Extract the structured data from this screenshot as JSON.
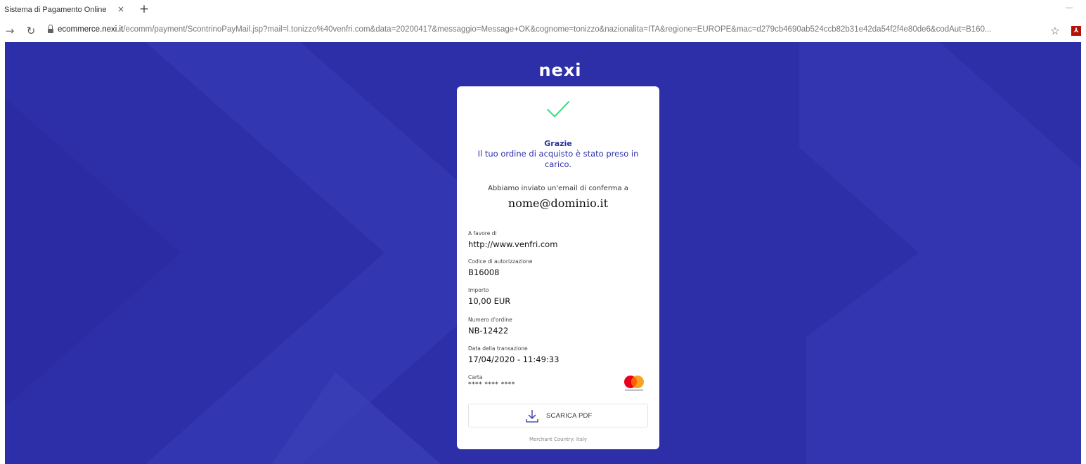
{
  "browser": {
    "tab_title": "Sistema di Pagamento Online",
    "tab_close": "×",
    "new_tab": "+",
    "url_host": "ecommerce.nexi.it",
    "url_path": "/ecomm/payment/ScontrinoPayMail.jsp?mail=l.tonizzo%40venfri.com&data=20200417&messaggio=Message+OK&cognome=tonizzo&nazionalita=ITA&regione=EUROPE&mac=d279cb4690ab524ccb82b31e42da54f2f4e80de6&codAut=B160..."
  },
  "brand": {
    "name": "nexi"
  },
  "receipt": {
    "thanks": "Grazie",
    "order_message": "Il tuo ordine di acquisto è stato preso in carico.",
    "email_message": "Abbiamo inviato un'email di conferma a",
    "email": "nome@dominio.it",
    "fields": [
      {
        "label": "A favore di",
        "value": "http://www.venfri.com"
      },
      {
        "label": "Codice di autorizzazione",
        "value": "B16008"
      },
      {
        "label": "Importo",
        "value": "10,00 EUR"
      },
      {
        "label": "Numero d'ordine",
        "value": "NB-12422"
      },
      {
        "label": "Data della transazione",
        "value": "17/04/2020 - 11:49:33"
      },
      {
        "label": "Carta",
        "value": "**** **** ****"
      }
    ],
    "card_brand": "mastercard",
    "download_label": "SCARICA PDF",
    "merchant_country": "Merchant Country: Italy"
  },
  "icons": {
    "success": "check-icon",
    "download": "download-icon",
    "card": "mastercard-logo-icon"
  },
  "colors": {
    "page_background": "#2d2fa8",
    "accent": "#2d2fa8",
    "success": "#3ddc84",
    "mastercard_red": "#eb001b",
    "mastercard_orange": "#f79e1b"
  }
}
